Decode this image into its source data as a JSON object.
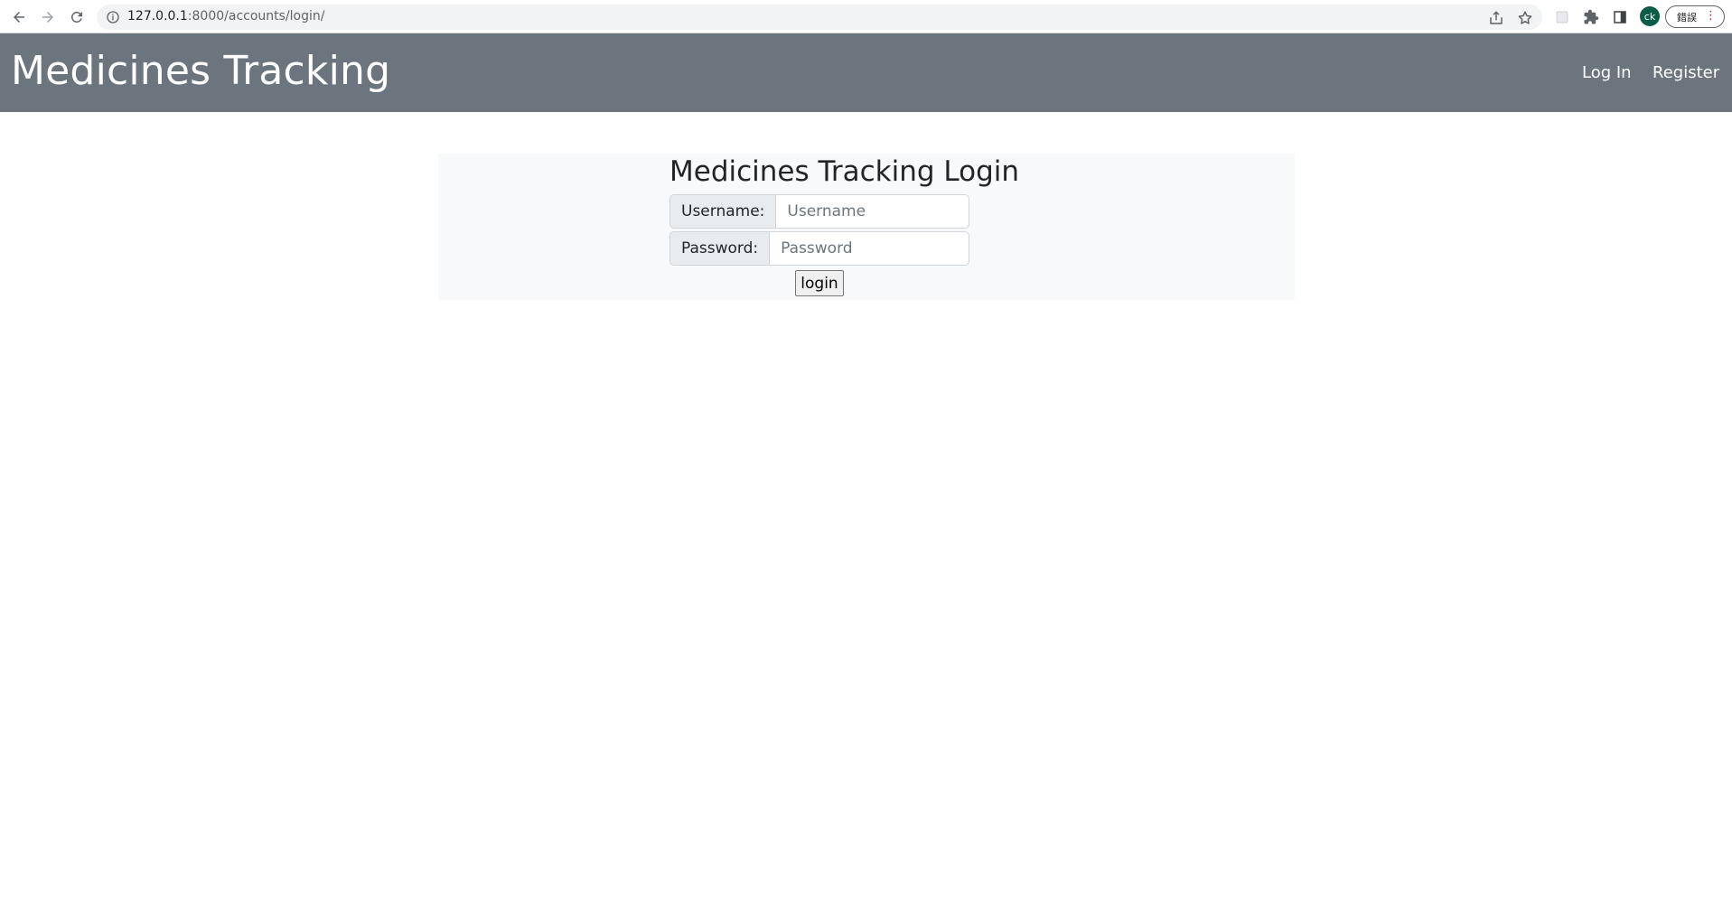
{
  "browser": {
    "url_host": "127.0.0.1",
    "url_rest": ":8000/accounts/login/",
    "profile_initials": "ck",
    "error_chip_label": "錯誤",
    "icons": {
      "back": "arrow-left-icon",
      "forward": "arrow-right-icon",
      "reload": "reload-icon",
      "site_info": "info-icon",
      "share": "share-icon",
      "bookmark": "star-icon",
      "extension": "extension-icon",
      "puzzle": "puzzle-icon",
      "side_panel": "side-panel-icon",
      "menu": "more-vertical-icon"
    }
  },
  "navbar": {
    "brand": "Medicines Tracking",
    "links": {
      "login": "Log In",
      "register": "Register"
    },
    "background": "#6c757d"
  },
  "login_form": {
    "title": "Medicines Tracking Login",
    "username_label": "Username:",
    "username_placeholder": "Username",
    "password_label": "Password:",
    "password_placeholder": "Password",
    "submit_label": "login",
    "panel_background": "#f8f9fa"
  }
}
